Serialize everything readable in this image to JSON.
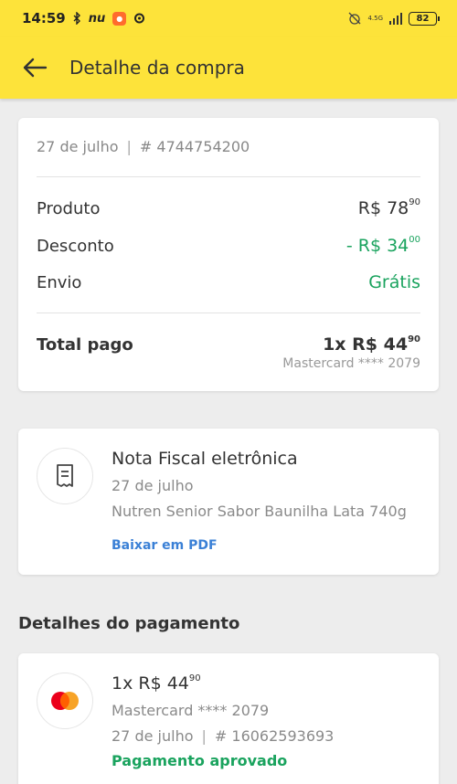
{
  "status_bar": {
    "time": "14:59",
    "nu": "nu",
    "network": "4.5G",
    "battery": "82"
  },
  "header": {
    "title": "Detalhe da compra"
  },
  "summary": {
    "date": "27 de julho",
    "separator": "|",
    "order": "# 4744754200",
    "rows": {
      "produto": {
        "label": "Produto",
        "value": "R$ 78",
        "cents": "90"
      },
      "desconto": {
        "label": "Desconto",
        "value": "- R$ 34",
        "cents": "00"
      },
      "envio": {
        "label": "Envio",
        "value": "Grátis"
      }
    },
    "total": {
      "label": "Total pago",
      "value": "1x R$ 44",
      "cents": "90",
      "card": "Mastercard **** 2079"
    }
  },
  "nota": {
    "title": "Nota Fiscal eletrônica",
    "date": "27 de julho",
    "product": "Nutren Senior Sabor Baunilha Lata 740g",
    "link": "Baixar em PDF",
    "icon": "receipt-icon"
  },
  "payment_section": {
    "title": "Detalhes do pagamento"
  },
  "payment": {
    "amount": "1x R$ 44",
    "cents": "90",
    "card": "Mastercard **** 2079",
    "date": "27 de julho",
    "separator": "|",
    "id": "# 16062593693",
    "status": "Pagamento aprovado",
    "icon": "mastercard-icon"
  },
  "colors": {
    "brand_yellow": "#fde33a",
    "green": "#1aa35e",
    "link_blue": "#3a80d6",
    "mastercard_red": "#eb001b",
    "mastercard_orange": "#f79e1b"
  }
}
